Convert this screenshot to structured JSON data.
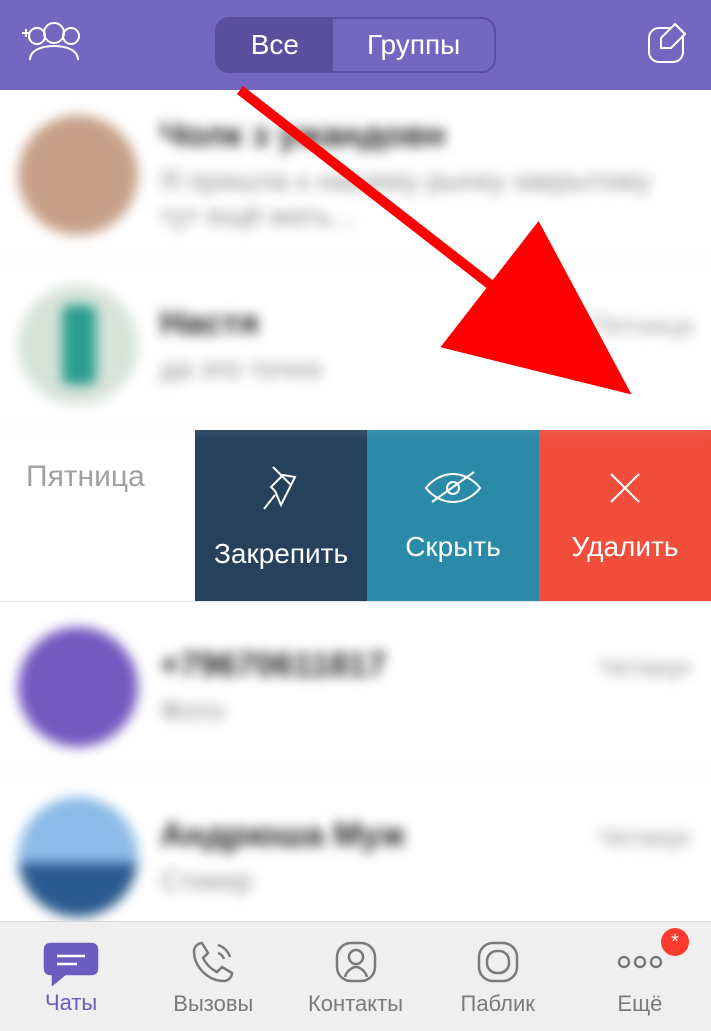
{
  "header": {
    "segment": {
      "all": "Все",
      "groups": "Группы"
    }
  },
  "chats": [
    {
      "name": "Чолк з ужандовн",
      "preview": "Я пришла к нашему рынку закрытому тут ещё мать...",
      "time": ""
    },
    {
      "name": "Настя",
      "preview": "да это точно",
      "time": "Пятница"
    },
    {
      "name": "+79670611817",
      "preview": "Фото",
      "time": "Четверг"
    },
    {
      "name": "Андрюша Муж",
      "preview": "Стикер",
      "time": "Четверг"
    }
  ],
  "swipe": {
    "day": "Пятница",
    "pin": "Закрепить",
    "hide": "Скрыть",
    "delete": "Удалить"
  },
  "tabs": {
    "chats": "Чаты",
    "calls": "Вызовы",
    "contacts": "Контакты",
    "public": "Паблик",
    "more": "Ещё",
    "badge": "*"
  },
  "colors": {
    "brand": "#7367c0",
    "pin": "#27415d",
    "hide": "#2a8aa8",
    "delete": "#f14f3b"
  }
}
